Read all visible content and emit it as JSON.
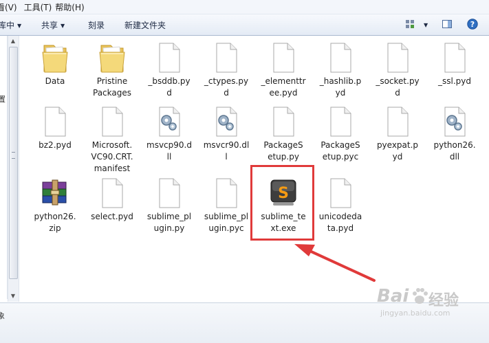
{
  "menubar": {
    "items": [
      "看(V)",
      "工具(T)",
      "帮助(H)"
    ]
  },
  "toolbar": {
    "organize_fragment": "库中",
    "share_label": "共享",
    "burn_label": "刻录",
    "new_folder_label": "新建文件夹",
    "view_icon": "view-grid-icon",
    "preview_icon": "preview-pane-icon",
    "help_icon": "help-icon"
  },
  "navpane": {
    "fragments": [
      "置",
      "象"
    ]
  },
  "files": [
    {
      "name": "Data",
      "icon": "folder-icon"
    },
    {
      "name": "Pristine\nPackages",
      "icon": "folder-icon"
    },
    {
      "name": "_bsddb.py\nd",
      "icon": "file-icon"
    },
    {
      "name": "_ctypes.py\nd",
      "icon": "file-icon"
    },
    {
      "name": "_elementtr\nee.pyd",
      "icon": "file-icon"
    },
    {
      "name": "_hashlib.p\nyd",
      "icon": "file-icon"
    },
    {
      "name": "_socket.py\nd",
      "icon": "file-icon"
    },
    {
      "name": "_ssl.pyd",
      "icon": "file-icon"
    },
    {
      "name": "bz2.pyd",
      "icon": "file-icon"
    },
    {
      "name": "Microsoft.\nVC90.CRT.\nmanifest",
      "icon": "file-icon"
    },
    {
      "name": "msvcp90.d\nll",
      "icon": "dll-icon"
    },
    {
      "name": "msvcr90.dl\nl",
      "icon": "dll-icon"
    },
    {
      "name": "PackageS\netup.py",
      "icon": "file-icon"
    },
    {
      "name": "PackageS\netup.pyc",
      "icon": "file-icon"
    },
    {
      "name": "pyexpat.p\nyd",
      "icon": "file-icon"
    },
    {
      "name": "python26.\ndll",
      "icon": "dll-icon"
    },
    {
      "name": "python26.\nzip",
      "icon": "winrar-archive-icon"
    },
    {
      "name": "select.pyd",
      "icon": "file-icon"
    },
    {
      "name": "sublime_pl\nugin.py",
      "icon": "file-icon"
    },
    {
      "name": "sublime_pl\nugin.pyc",
      "icon": "file-icon"
    },
    {
      "name": "sublime_te\nxt.exe",
      "icon": "sublime-text-icon"
    },
    {
      "name": "unicodeda\nta.pyd",
      "icon": "file-icon"
    }
  ],
  "watermark": {
    "brand": "Bai",
    "brand_tail": "经验",
    "url": "jingyan.baidu.com"
  },
  "colors": {
    "annotation": "#e03a3a",
    "folder": "#f2d36b"
  }
}
